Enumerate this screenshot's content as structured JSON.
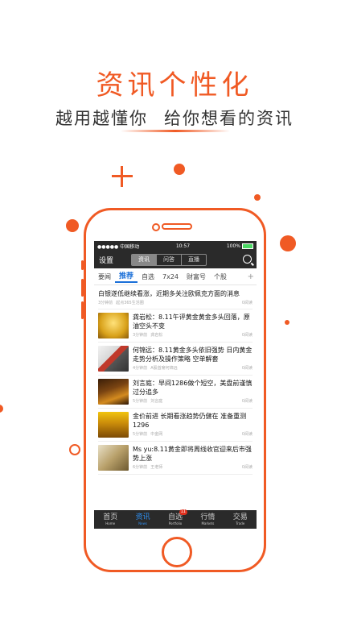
{
  "promo": {
    "title": "资讯个性化",
    "subtitle_a": "越用越懂你",
    "subtitle_b": "给你想看的资讯"
  },
  "colors": {
    "accent": "#f05a24",
    "selected_tab": "#2f8ff0"
  },
  "status_bar": {
    "carrier": "●●●●● 中国移动",
    "time": "10:57",
    "battery": "100%",
    "battery_level": 1.0
  },
  "header": {
    "settings_label": "设置",
    "segments": [
      "资讯",
      "问答",
      "直播"
    ],
    "active_segment": "资讯",
    "search_icon": "search-icon"
  },
  "categories": {
    "items": [
      "要闻",
      "推荐",
      "自选",
      "7x24",
      "财富号",
      "个股"
    ],
    "active": "推荐",
    "add_icon": "+"
  },
  "news": {
    "first": {
      "title": "白银遂低继续看涨，近期多关注欧佩克方面的消息",
      "time": "3分钟前",
      "source": "起点365生活圈",
      "reads": "0阅读"
    },
    "items": [
      {
        "title": "龚岩松：8.11午评黄金黄金多头回落，原油空头不变",
        "time": "3分钟前",
        "source": "龚岩松",
        "reads": "0阅读"
      },
      {
        "title": "何锦远：8.11黄金多头依旧强势 日内黄金走势分析及操作策略 空单解套",
        "time": "4分钟前",
        "source": "A股首席何锦远",
        "reads": "0阅读"
      },
      {
        "title": "刘言庭：早间1286做个短空，美盘前谨慎过分追多",
        "time": "5分钟前",
        "source": "刘言庭",
        "reads": "0阅读"
      },
      {
        "title": "金价前进 长期看涨趋势仍健在 准备重测1296",
        "time": "5分钟前",
        "source": "中金网",
        "reads": "0阅读"
      },
      {
        "title": "Ms yu:8.11黄金即将周线收官迎来后市强势上涨",
        "time": "6分钟前",
        "source": "王老师",
        "reads": "0阅读"
      }
    ]
  },
  "tab_bar": {
    "tabs": [
      {
        "zh": "首页",
        "en": "Home"
      },
      {
        "zh": "资讯",
        "en": "News"
      },
      {
        "zh": "自选",
        "en": "Portfolio",
        "badge": "11"
      },
      {
        "zh": "行情",
        "en": "Markets"
      },
      {
        "zh": "交易",
        "en": "Trade"
      }
    ],
    "active": "资讯"
  }
}
